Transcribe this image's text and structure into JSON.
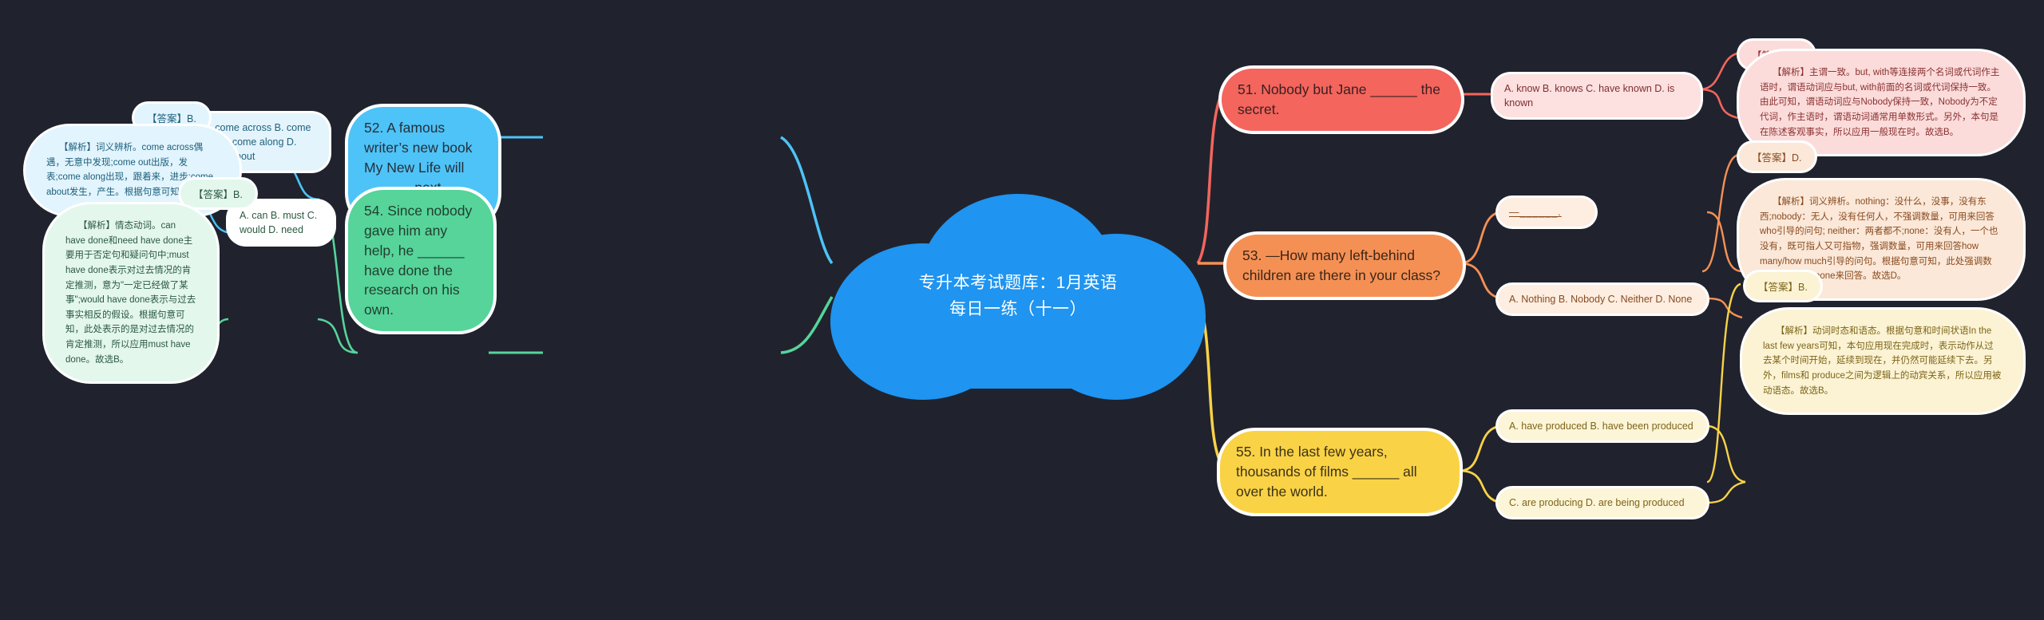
{
  "central": {
    "title_line1": "专升本考试题库：1月英语",
    "title_line2": "每日一练（十一）",
    "color": "#1f94f0"
  },
  "branches": [
    {
      "id": "q51",
      "color": "#f4655d",
      "question": "51. Nobody but Jane ______ the secret.",
      "options": [
        "A. know B. knows C. have known D. is known"
      ],
      "answer": "【答案】B.",
      "explanation": "【解析】主谓一致。but, with等连接两个名词或代词作主语时，谓语动词应与but, with前面的名词或代词保持一致。由此可知，谓语动词应与Nobody保持一致，Nobody为不定代词，作主语时，谓语动词通常用单数形式。另外，本句是在陈述客观事实，所以应用一般现在时。故选B。"
    },
    {
      "id": "q52",
      "color": "#4ec3f7",
      "question": "52. A famous writer’s new book My New Life will ______ next month.",
      "options": [
        "A. come across B. come out C. come along D. come about"
      ],
      "answer": "【答案】B.",
      "explanation": "【解析】词义辨析。come across偶遇，无意中发现;come out出版，发表;come along出现，跟着来，进步;come about发生，产生。根据句意可知，选B。"
    },
    {
      "id": "q53",
      "color": "#f59055",
      "question": "53. —How many left-behind children are there in your class?",
      "options": [
        "—______.",
        "A. Nothing B. Nobody C. Neither D. None"
      ],
      "answer": "【答案】D.",
      "explanation": "【解析】词义辨析。nothing：没什么，没事，没有东西;nobody：无人，没有任何人，不强调数量，可用来回答who引导的问句; neither：两者都不;none：没有人，一个也没有，既可指人又可指物，强调数量，可用来回答how many/how much引导的问句。根据句意可知，此处强调数量，所以应用none来回答。故选D。"
    },
    {
      "id": "q54",
      "color": "#56d49a",
      "question": "54. Since nobody gave him any help, he ______ have done the research on his own.",
      "options": [
        "A. can B. must C. would D. need"
      ],
      "answer": "【答案】B.",
      "explanation": "【解析】情态动词。can have done和need have done主要用于否定句和疑问句中;must have done表示对过去情况的肯定推测，意为\"一定已经做了某事\";would have done表示与过去事实相反的假设。根据句意可知，此处表示的是对过去情况的肯定推测，所以应用must have done。故选B。"
    },
    {
      "id": "q55",
      "color": "#fad246",
      "question": "55. In the last few years, thousands of films ______ all over the world.",
      "options": [
        "A. have produced B. have been produced",
        "C. are producing D. are being produced"
      ],
      "answer": "【答案】B.",
      "explanation": "【解析】动词时态和语态。根据句意和时间状语In the last few years可知，本句应用现在完成时，表示动作从过去某个时间开始，延续到现在，并仍然可能延续下去。另外，films和 produce之间为逻辑上的动宾关系，所以应用被动语态。故选B。"
    }
  ]
}
